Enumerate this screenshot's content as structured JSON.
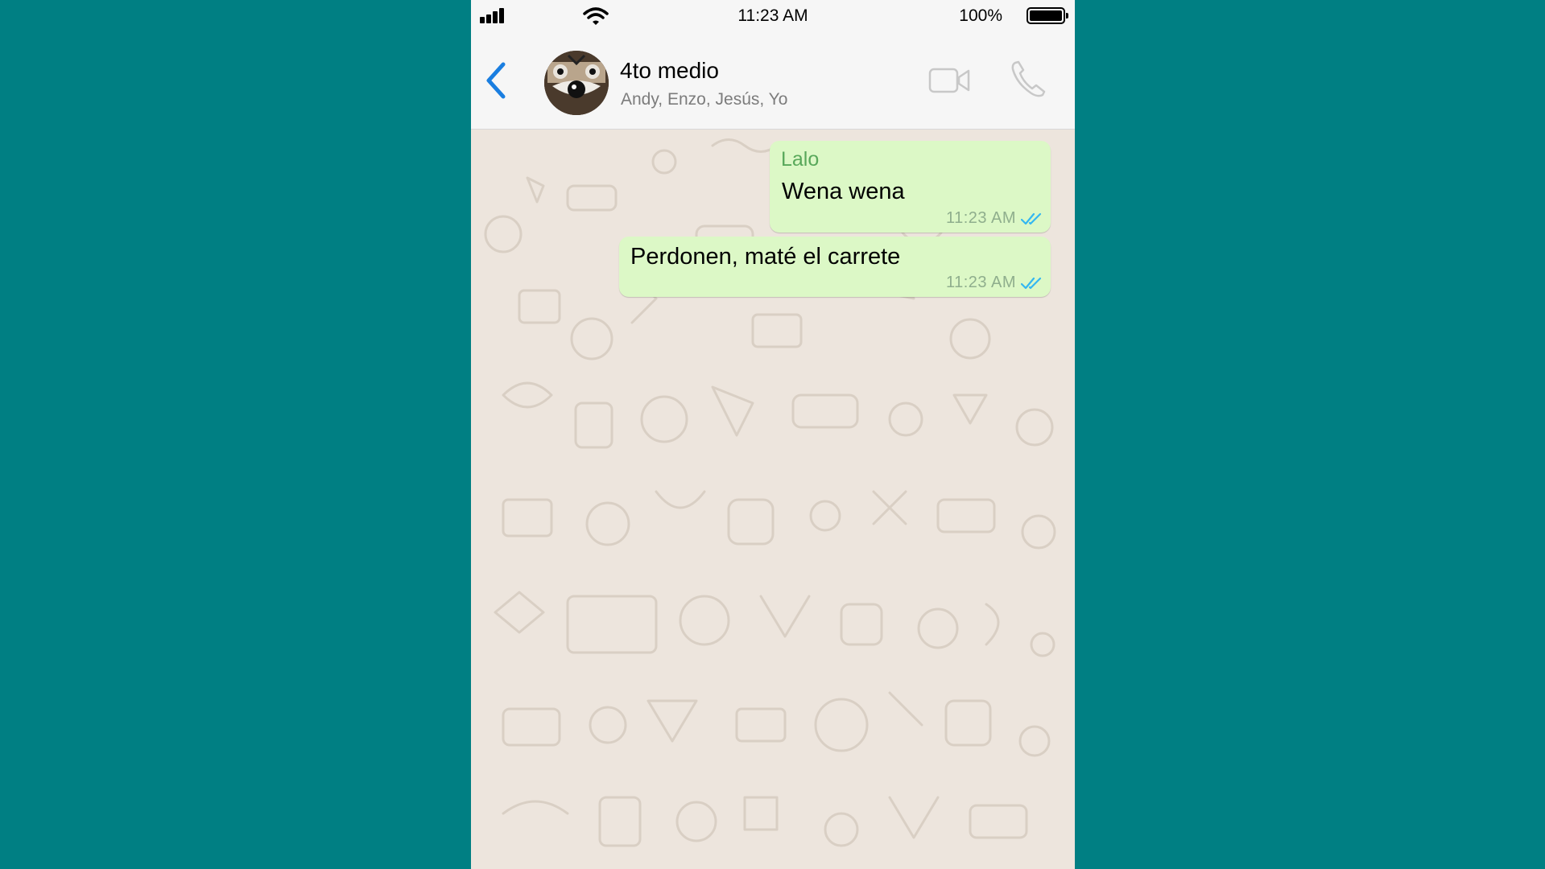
{
  "status_bar": {
    "time": "11:23 AM",
    "battery_percent": "100%"
  },
  "chat": {
    "title": "4to medio",
    "members": "Andy, Enzo, Jesús, Yo"
  },
  "messages": [
    {
      "sender": "Lalo",
      "text": "Wena wena",
      "time": "11:23 AM",
      "status": "read"
    },
    {
      "sender": "",
      "text": "Perdonen, maté el carrete",
      "time": "11:23 AM",
      "status": "read"
    }
  ],
  "colors": {
    "backdrop": "#007f83",
    "accent_blue": "#1a7ee0",
    "bubble_outgoing": "#dcf8c6",
    "sender_name": "#58a85a",
    "read_ticks": "#34b7f1",
    "wallpaper": "#ede5dd"
  },
  "icons": {
    "back": "chevron-left-icon",
    "video": "video-camera-icon",
    "call": "phone-icon",
    "read": "double-check-icon"
  }
}
